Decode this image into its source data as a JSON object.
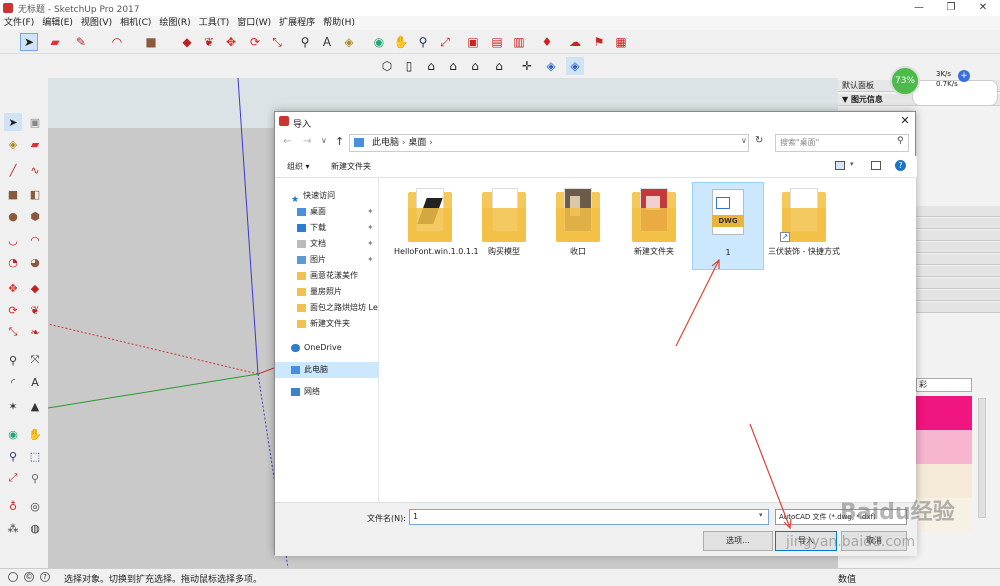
{
  "window": {
    "title": "无标题 - SketchUp Pro 2017",
    "minimize": "—",
    "maximize": "❐",
    "close": "✕"
  },
  "menu": [
    "文件(F)",
    "编辑(E)",
    "视图(V)",
    "相机(C)",
    "绘图(R)",
    "工具(T)",
    "窗口(W)",
    "扩展程序",
    "帮助(H)"
  ],
  "right_panel": {
    "header": "默认面板",
    "section": "▼ 图元信息",
    "dropdown_text": "彩",
    "color_swatches": [
      "#f0157f",
      "#f7b5cf",
      "#f5ead8",
      "#f7f0e4"
    ]
  },
  "network_widget": {
    "percent": "73%",
    "up": "3K/s",
    "down": "0.7K/s"
  },
  "status": {
    "text": "选择对象。切换到扩充选择。拖动鼠标选择多项。",
    "right_label": "数值"
  },
  "dialog": {
    "title": "导入",
    "breadcrumb": [
      "此电脑",
      "桌面"
    ],
    "search_placeholder": "搜索\"桌面\"",
    "organize": "组织 ▾",
    "new_folder": "新建文件夹",
    "nav": [
      {
        "label": "快速访问",
        "icon": "star-icon",
        "pinned": false
      },
      {
        "label": "桌面",
        "icon": "desktop-icon",
        "pinned": true
      },
      {
        "label": "下载",
        "icon": "download-icon",
        "pinned": true
      },
      {
        "label": "文档",
        "icon": "document-icon",
        "pinned": true
      },
      {
        "label": "图片",
        "icon": "picture-icon",
        "pinned": true
      },
      {
        "label": "画意花漾美作",
        "icon": "folder-icon",
        "pinned": false
      },
      {
        "label": "量房照片",
        "icon": "folder-icon",
        "pinned": false
      },
      {
        "label": "面包之路烘焙坊  Le",
        "icon": "folder-icon",
        "pinned": false
      },
      {
        "label": "新建文件夹",
        "icon": "folder-icon",
        "pinned": false
      },
      {
        "label": "OneDrive",
        "icon": "cloud-icon",
        "pinned": false
      },
      {
        "label": "此电脑",
        "icon": "computer-icon",
        "pinned": false
      },
      {
        "label": "网络",
        "icon": "network-icon",
        "pinned": false
      }
    ],
    "files": [
      {
        "name": "HelloFont.win.1.0.1.1",
        "kind": "folder-doc"
      },
      {
        "name": "购买模型",
        "kind": "folder-doc"
      },
      {
        "name": "收口",
        "kind": "folder-photo"
      },
      {
        "name": "新建文件夹",
        "kind": "folder-red"
      },
      {
        "name": "1",
        "kind": "dwg"
      },
      {
        "name": "三伏装饰 - 快捷方式",
        "kind": "shortcut"
      }
    ],
    "filename_label": "文件名(N):",
    "filename_value": "1",
    "filetype_value": "AutoCAD 文件 (*.dwg, *.dxf)",
    "options_button": "选项...",
    "import_button": "导入",
    "cancel_button": "取消"
  },
  "watermark": {
    "brand": "Baidu经验",
    "url": "jingyan.baidu.com"
  },
  "colors": {
    "accent": "#0078d7",
    "selected_bg": "#cce8ff",
    "annotation": "#d9463a"
  }
}
